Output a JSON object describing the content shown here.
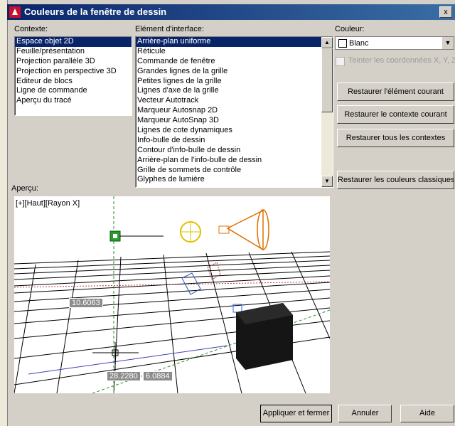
{
  "window": {
    "title": "Couleurs de la fenêtre de dessin",
    "close_glyph": "x"
  },
  "context": {
    "label": "Contexte:",
    "items": [
      "Espace objet 2D",
      "Feuille/présentation",
      "Projection parallèle 3D",
      "Projection en perspective 3D",
      "Editeur de blocs",
      "Ligne de commande",
      "Aperçu du tracé"
    ],
    "selected": 0
  },
  "interface": {
    "label": "Elément d'interface:",
    "items": [
      "Arrière-plan uniforme",
      "Réticule",
      "Commande de fenêtre",
      "Grandes lignes de la grille",
      "Petites lignes de la grille",
      "Lignes d'axe de la grille",
      "Vecteur Autotrack",
      "Marqueur Autosnap 2D",
      "Marqueur AutoSnap 3D",
      "Lignes de cote dynamiques",
      "Info-bulle de dessin",
      "Contour d'info-bulle de dessin",
      "Arrière-plan de l'info-bulle de dessin",
      "Grille de sommets de contrôle",
      "Glyphes de lumière"
    ],
    "selected": 0
  },
  "color": {
    "label": "Couleur:",
    "value": "Blanc",
    "tint_label": "Teinter les coordonnées X, Y, Z"
  },
  "buttons": {
    "restore_element": "Restaurer l'élément courant",
    "restore_context": "Restaurer le contexte courant",
    "restore_all": "Restaurer tous les contextes",
    "restore_classic": "Restaurer les couleurs classiques",
    "apply_close": "Appliquer et fermer",
    "cancel": "Annuler",
    "help": "Aide"
  },
  "preview": {
    "label": "Aperçu:",
    "viewport_label": "[+][Haut][Rayon X]",
    "dim1": "10.6063",
    "dim2": "28.2280",
    "dim3": "6.0884"
  },
  "colors": {
    "selection": "#0a246a",
    "face": "#d4d0c8",
    "title": "#0a246a"
  }
}
